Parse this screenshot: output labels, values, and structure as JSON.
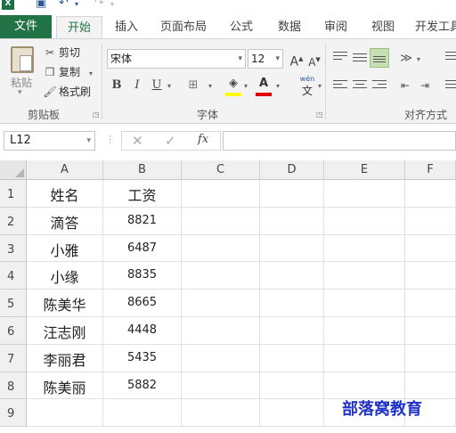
{
  "app": {
    "logo": "X"
  },
  "tabs": [
    "文件",
    "开始",
    "插入",
    "页面布局",
    "公式",
    "数据",
    "审阅",
    "视图",
    "开发工具"
  ],
  "active_tab": "开始",
  "clipboard": {
    "paste": "粘贴",
    "cut": "剪切",
    "copy": "复制",
    "format_painter": "格式刷",
    "group": "剪贴板"
  },
  "font": {
    "name": "宋体",
    "size": "12",
    "group": "字体",
    "bold": "B",
    "italic": "I",
    "underline": "U",
    "wen": "wén",
    "wen_char": "文",
    "grow": "A",
    "shrink": "A"
  },
  "alignment": {
    "group": "对齐方式"
  },
  "formula_bar": {
    "name_box": "L12",
    "cancel": "✕",
    "enter": "✓",
    "fx": "fx",
    "formula": ""
  },
  "columns": [
    "A",
    "B",
    "C",
    "D",
    "E",
    "F"
  ],
  "rows": [
    {
      "num": "1",
      "a": "姓名",
      "b": "工资"
    },
    {
      "num": "2",
      "a": "滴答",
      "b": "8821"
    },
    {
      "num": "3",
      "a": "小雅",
      "b": "6487"
    },
    {
      "num": "4",
      "a": "小缘",
      "b": "8835"
    },
    {
      "num": "5",
      "a": "陈美华",
      "b": "8665"
    },
    {
      "num": "6",
      "a": "汪志刚",
      "b": "4448"
    },
    {
      "num": "7",
      "a": "李丽君",
      "b": "5435"
    },
    {
      "num": "8",
      "a": "陈美丽",
      "b": "5882"
    },
    {
      "num": "9",
      "a": "",
      "b": ""
    }
  ],
  "watermark": "部落窝教育",
  "colors": {
    "file_tab": "#217346",
    "accent": "#217346",
    "watermark": "#1f32c8"
  }
}
